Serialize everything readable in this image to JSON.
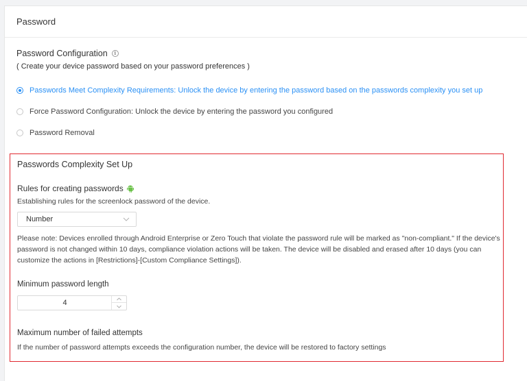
{
  "page": {
    "title": "Password"
  },
  "password_config": {
    "title": "Password Configuration",
    "info_icon": "info-icon",
    "subtitle": "( Create your device password based on your password preferences )",
    "options": [
      {
        "label": "Passwords Meet Complexity Requirements: Unlock the device by entering the password based on the passwords complexity you set up",
        "selected": true
      },
      {
        "label": "Force Password Configuration: Unlock the device by entering the password you configured",
        "selected": false
      },
      {
        "label": "Password Removal",
        "selected": false
      }
    ]
  },
  "complexity": {
    "title": "Passwords Complexity Set Up",
    "rules_label": "Rules for creating passwords",
    "rules_icon": "android-icon",
    "rules_desc": "Establishing rules for the screenlock password of the device.",
    "rule_type": {
      "value": "Number"
    },
    "note": "Please note: Devices enrolled through Android Enterprise or Zero Touch that violate the password rule will be marked as \"non-compliant.\" If the device's password is not changed within 10 days, compliance violation actions will be taken. The device will be disabled and erased after 10 days (you can customize the actions in [Restrictions]-[Custom Compliance Settings]).",
    "min_length": {
      "label": "Minimum password length",
      "value": "4"
    },
    "max_failed": {
      "label": "Maximum number of failed attempts",
      "desc": "If the number of password attempts exceeds the configuration number, the device will be restored to factory settings"
    }
  },
  "colors": {
    "accent": "#2a90f5",
    "highlight_border": "#e0282f",
    "android": "#6cc24a"
  }
}
